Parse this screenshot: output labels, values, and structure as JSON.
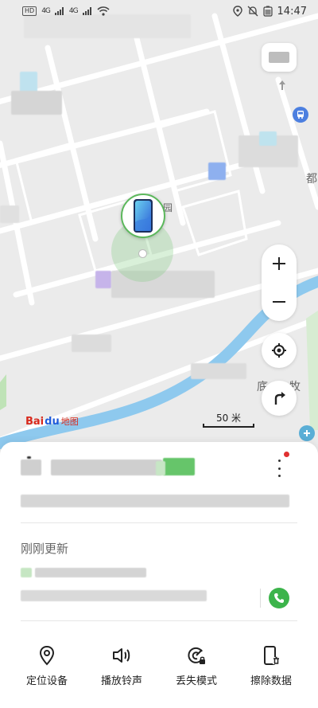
{
  "status_bar": {
    "time": "14:47",
    "hd_badge": "HD",
    "net1": "4G",
    "net2": "4G"
  },
  "map": {
    "logo_bai": "Bai",
    "logo_du": "du",
    "logo_ditu": "地图",
    "scale_label": "50 米",
    "poi_fragment_yuan": "园",
    "poi_fragment_right": "都",
    "poi_fragment_bottom": "底",
    "poi_fragment_bottom2": "牧"
  },
  "card": {
    "updated_label": "刚刚更新"
  },
  "actions": [
    {
      "label": "定位设备",
      "icon": "location-pin-icon"
    },
    {
      "label": "播放铃声",
      "icon": "speaker-icon"
    },
    {
      "label": "丢失模式",
      "icon": "lost-mode-icon"
    },
    {
      "label": "擦除数据",
      "icon": "erase-phone-icon"
    }
  ],
  "colors": {
    "accent_green": "#3cb44b",
    "marker_green": "#5cb85c",
    "river_blue": "#7fc3ea",
    "notification_red": "#e03030"
  }
}
